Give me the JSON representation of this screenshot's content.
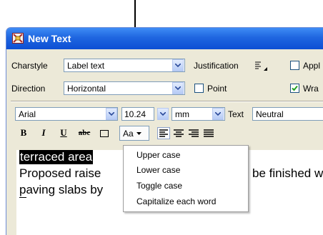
{
  "window": {
    "title": "New Text"
  },
  "row1": {
    "charstyle_label": "Charstyle",
    "charstyle_value": "Label text",
    "justification_label": "Justification",
    "apply_label": "Appl"
  },
  "row2": {
    "direction_label": "Direction",
    "direction_value": "Horizontal",
    "point_label": "Point",
    "wrap_label": "Wra"
  },
  "font_row": {
    "font_value": "Arial",
    "size_value": "10.24",
    "unit_value": "mm",
    "text_label": "Text",
    "text_value": "Neutral"
  },
  "format_row": {
    "bold": "B",
    "italic": "I",
    "underline": "U",
    "strike": "abc",
    "case_button": "Aa"
  },
  "editor": {
    "line1": "terraced area",
    "line2_left": "Proposed raise",
    "line2_right": "be finished w",
    "line3_left": "paving slabs by"
  },
  "case_menu": {
    "items": [
      "Upper case",
      "Lower case",
      "Toggle case",
      "Capitalize each word"
    ]
  }
}
